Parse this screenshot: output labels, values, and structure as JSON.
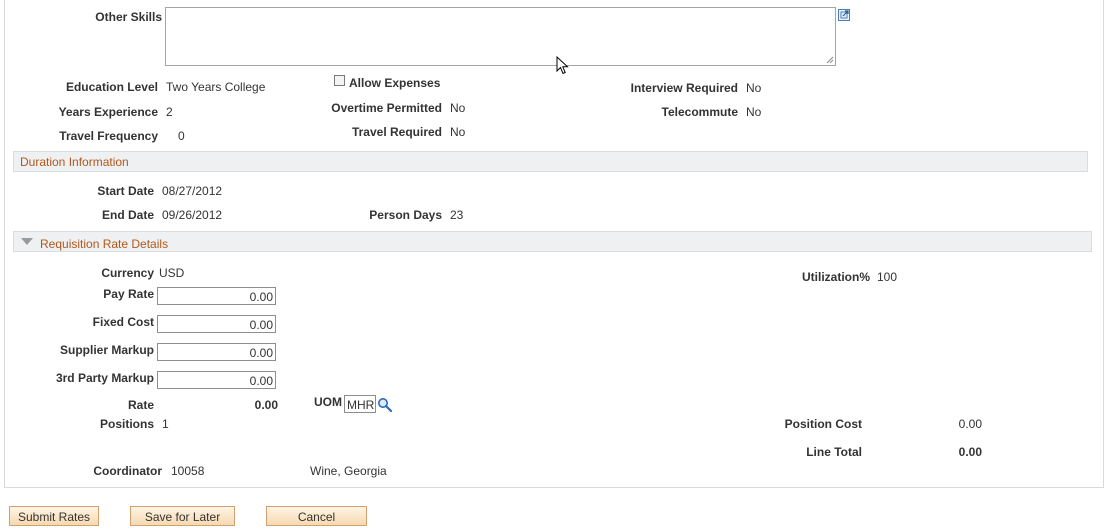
{
  "skills": {
    "label": "Other Skills",
    "value": ""
  },
  "details": {
    "education_level": {
      "label": "Education Level",
      "value": "Two Years College"
    },
    "years_experience": {
      "label": "Years Experience",
      "value": "2"
    },
    "travel_frequency": {
      "label": "Travel Frequency",
      "value": "0"
    },
    "allow_expenses": {
      "label": "Allow Expenses",
      "checked": false
    },
    "overtime_permitted": {
      "label": "Overtime Permitted",
      "value": "No"
    },
    "travel_required": {
      "label": "Travel Required",
      "value": "No"
    },
    "interview_required": {
      "label": "Interview Required",
      "value": "No"
    },
    "telecommute": {
      "label": "Telecommute",
      "value": "No"
    }
  },
  "duration": {
    "title": "Duration Information",
    "start_date": {
      "label": "Start Date",
      "value": "08/27/2012"
    },
    "end_date": {
      "label": "End Date",
      "value": "09/26/2012"
    },
    "person_days": {
      "label": "Person Days",
      "value": "23"
    }
  },
  "rates": {
    "title": "Requisition Rate Details",
    "currency": {
      "label": "Currency",
      "value": "USD"
    },
    "utilization": {
      "label": "Utilization%",
      "value": "100"
    },
    "pay_rate": {
      "label": "Pay Rate",
      "value": "0.00"
    },
    "fixed_cost": {
      "label": "Fixed Cost",
      "value": "0.00"
    },
    "supplier_markup": {
      "label": "Supplier Markup",
      "value": "0.00"
    },
    "third_party_markup": {
      "label": "3rd Party Markup",
      "value": "0.00"
    },
    "rate": {
      "label": "Rate",
      "value": "0.00"
    },
    "uom": {
      "label": "UOM",
      "value": "MHR"
    },
    "positions": {
      "label": "Positions",
      "value": "1"
    },
    "position_cost": {
      "label": "Position Cost",
      "value": "0.00"
    },
    "line_total": {
      "label": "Line Total",
      "value": "0.00"
    },
    "coordinator": {
      "label": "Coordinator",
      "id": "10058",
      "name": "Wine, Georgia"
    }
  },
  "buttons": {
    "submit": "Submit Rates",
    "save": "Save for Later",
    "cancel": "Cancel"
  },
  "colors": {
    "section_title": "#b2581a",
    "section_bar": "#eef0f2",
    "button_bg": "#f6d9b1"
  },
  "icons": {
    "expand": "expand-icon",
    "lookup": "lookup-icon",
    "collapse": "collapse-triangle-icon",
    "cursor": "mouse-pointer-icon"
  }
}
